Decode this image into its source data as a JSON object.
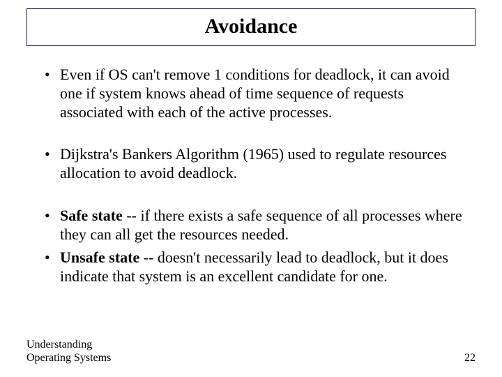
{
  "title": "Avoidance",
  "bullets": {
    "b1": "Even if OS can't remove 1 conditions for deadlock, it can avoid one if system knows ahead of time sequence of requests associated with each of the active processes.",
    "b2": "Dijkstra's Bankers Algorithm (1965) used to regulate resources allocation to avoid deadlock.",
    "b3_strong": "Safe state",
    "b3_rest": " -- if there exists a safe sequence of all processes where they can all get the resources needed.",
    "b4_strong": "Unsafe state",
    "b4_rest": " -- doesn't necessarily lead to deadlock, but it does indicate that system is an excellent candidate for one."
  },
  "footer": {
    "left_line1": "Understanding",
    "left_line2": "Operating Systems",
    "page": "22"
  }
}
